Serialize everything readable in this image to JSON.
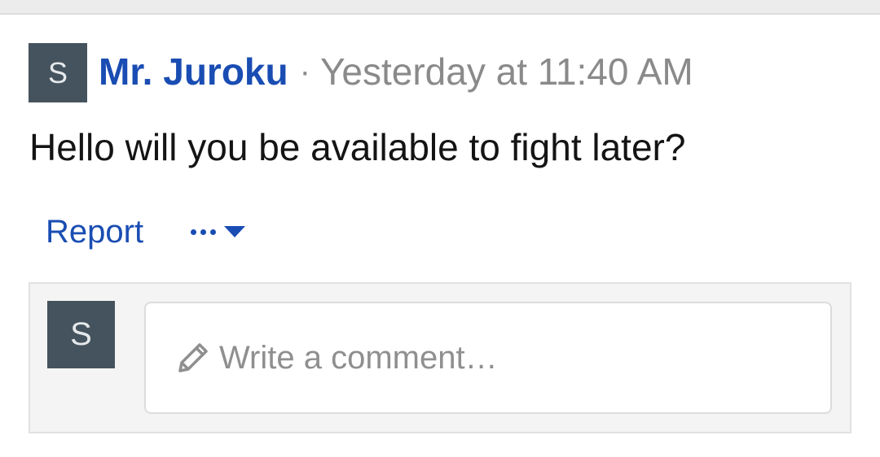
{
  "post": {
    "author_initial": "S",
    "author_name": "Mr. Juroku",
    "separator": "·",
    "timestamp": "Yesterday at 11:40 AM",
    "message": "Hello will you be available to fight later?"
  },
  "actions": {
    "report_label": "Report",
    "more_icon": "ellipsis-icon",
    "dropdown_icon": "caret-down-icon"
  },
  "comment": {
    "avatar_initial": "S",
    "placeholder": "Write a comment…",
    "icon": "pencil-icon"
  },
  "colors": {
    "link": "#1a4db3",
    "avatar_bg": "#45535e",
    "muted_text": "#8a8a8a"
  }
}
